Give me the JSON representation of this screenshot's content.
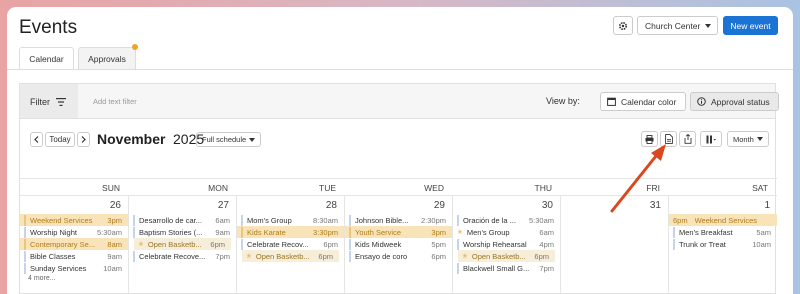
{
  "header": {
    "title": "Events",
    "org_dropdown": "Church Center",
    "new_event_label": "New event"
  },
  "tabs": [
    {
      "label": "Calendar",
      "active": true
    },
    {
      "label": "Approvals",
      "active": false,
      "has_notification": true
    }
  ],
  "filter": {
    "label": "Filter",
    "placeholder": "Add text filter",
    "view_by_label": "View by:",
    "view_options": [
      {
        "label": "Calendar color",
        "active": false
      },
      {
        "label": "Approval status",
        "active": true
      }
    ]
  },
  "calendar": {
    "today_label": "Today",
    "month": "November",
    "year": "2025",
    "schedule": "Full schedule",
    "view": "Month",
    "weekdays": [
      "SUN",
      "MON",
      "TUE",
      "WED",
      "THU",
      "FRI",
      "SAT"
    ],
    "days": [
      {
        "num": "26",
        "events": [
          {
            "title": "Weekend Services",
            "time": "3pm",
            "status": "pending"
          },
          {
            "title": "Worship Night",
            "time": "5:30am",
            "status": "approved"
          },
          {
            "title": "Contemporary Se...",
            "time": "8am",
            "status": "pending"
          },
          {
            "title": "Bible Classes",
            "time": "9am",
            "status": "approved"
          },
          {
            "title": "Sunday Services",
            "time": "10am",
            "status": "approved"
          }
        ],
        "more": "4 more..."
      },
      {
        "num": "27",
        "events": [
          {
            "title": "Desarrollo de car...",
            "time": "6am",
            "status": "approved"
          },
          {
            "title": "Baptism Stories (...",
            "time": "9am",
            "status": "approved"
          },
          {
            "title": "Open Basketb...",
            "time": "6pm",
            "status": "partial"
          },
          {
            "title": "Celebrate Recove...",
            "time": "7pm",
            "status": "approved"
          }
        ]
      },
      {
        "num": "28",
        "events": [
          {
            "title": "Mom's Group",
            "time": "8:30am",
            "status": "approved"
          },
          {
            "title": "Kids Karate",
            "time": "3:30pm",
            "status": "pending"
          },
          {
            "title": "Celebrate Recov...",
            "time": "6pm",
            "status": "approved"
          },
          {
            "title": "Open Basketb...",
            "time": "6pm",
            "status": "partial"
          }
        ]
      },
      {
        "num": "29",
        "events": [
          {
            "title": "Johnson Bible...",
            "time": "2:30pm",
            "status": "approved"
          },
          {
            "title": "Youth Service",
            "time": "3pm",
            "status": "pending"
          },
          {
            "title": "Kids Midweek",
            "time": "5pm",
            "status": "approved"
          },
          {
            "title": "Ensayo de coro",
            "time": "6pm",
            "status": "approved"
          }
        ]
      },
      {
        "num": "30",
        "events": [
          {
            "title": "Oración de la ...",
            "time": "5:30am",
            "status": "approved"
          },
          {
            "title": "Men's Group",
            "time": "6am",
            "status": "approved_star"
          },
          {
            "title": "Worship Rehearsal",
            "time": "4pm",
            "status": "approved"
          },
          {
            "title": "Open Basketb...",
            "time": "6pm",
            "status": "partial"
          },
          {
            "title": "Blackwell Small G...",
            "time": "7pm",
            "status": "approved"
          }
        ]
      },
      {
        "num": "31",
        "events": []
      },
      {
        "num": "1",
        "events": [
          {
            "title": "Weekend Services",
            "time": "6pm",
            "status": "pending_pre"
          },
          {
            "title": "Men's Breakfast",
            "time": "5am",
            "status": "approved"
          },
          {
            "title": "Trunk or Treat",
            "time": "10am",
            "status": "approved"
          }
        ]
      }
    ]
  },
  "colors": {
    "primary": "#1b74d4",
    "pending_bg": "#f8e4b8",
    "approved_bar": "#c5d3ec",
    "annotation_arrow": "#d9481e"
  }
}
